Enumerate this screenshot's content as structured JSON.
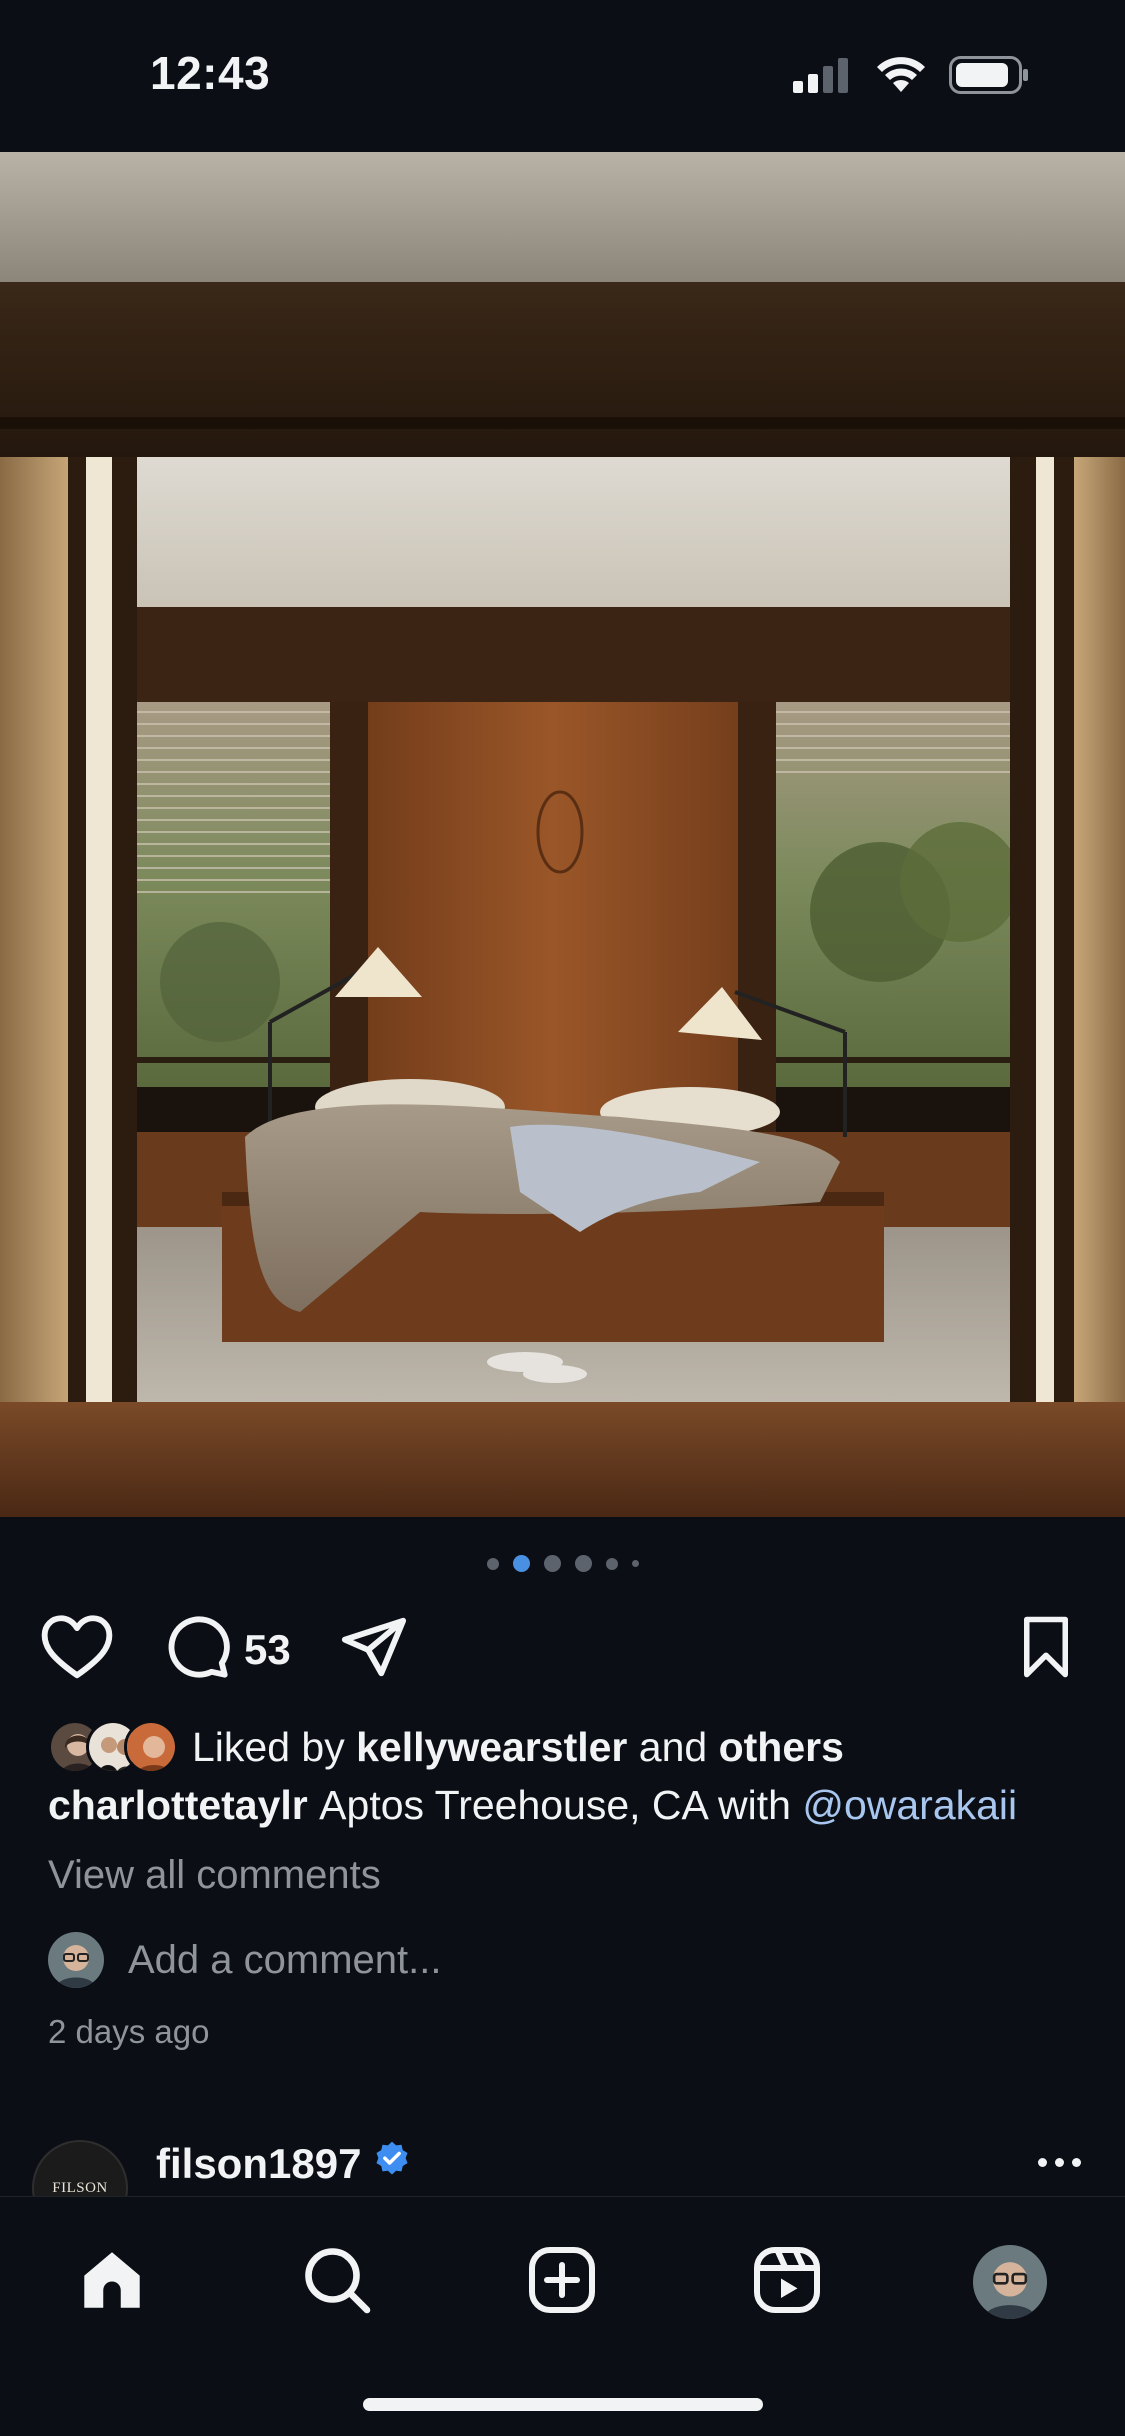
{
  "status_bar": {
    "time": "12:43",
    "icons": [
      "cellular-signal-icon",
      "wifi-icon",
      "battery-icon"
    ]
  },
  "post": {
    "image_alt_icon": "bedroom-photo",
    "carousel": {
      "count": 6,
      "active_index": 1
    },
    "comment_count": "53",
    "liked_by": {
      "prefix": "Liked by",
      "user": "kellywearstler",
      "joiner": "and",
      "suffix": "others"
    },
    "caption": {
      "username": "charlottetaylr",
      "text": "Aptos Treehouse, CA with",
      "mention": "@owarakaii"
    },
    "view_all_comments": "View all comments",
    "comment_placeholder": "Add a comment...",
    "time_ago": "2 days ago"
  },
  "next_post": {
    "avatar_text": "FILSON",
    "username": "filson1897",
    "verified": true
  },
  "tab_bar": {
    "items": [
      "home-icon",
      "search-icon",
      "create-icon",
      "reels-icon",
      "profile-avatar"
    ]
  },
  "colors": {
    "background": "#0b0f15",
    "text": "#f2f3f5",
    "muted": "#8f949b",
    "mention": "#a9c6ef",
    "accent_blue": "#4a90e2"
  }
}
